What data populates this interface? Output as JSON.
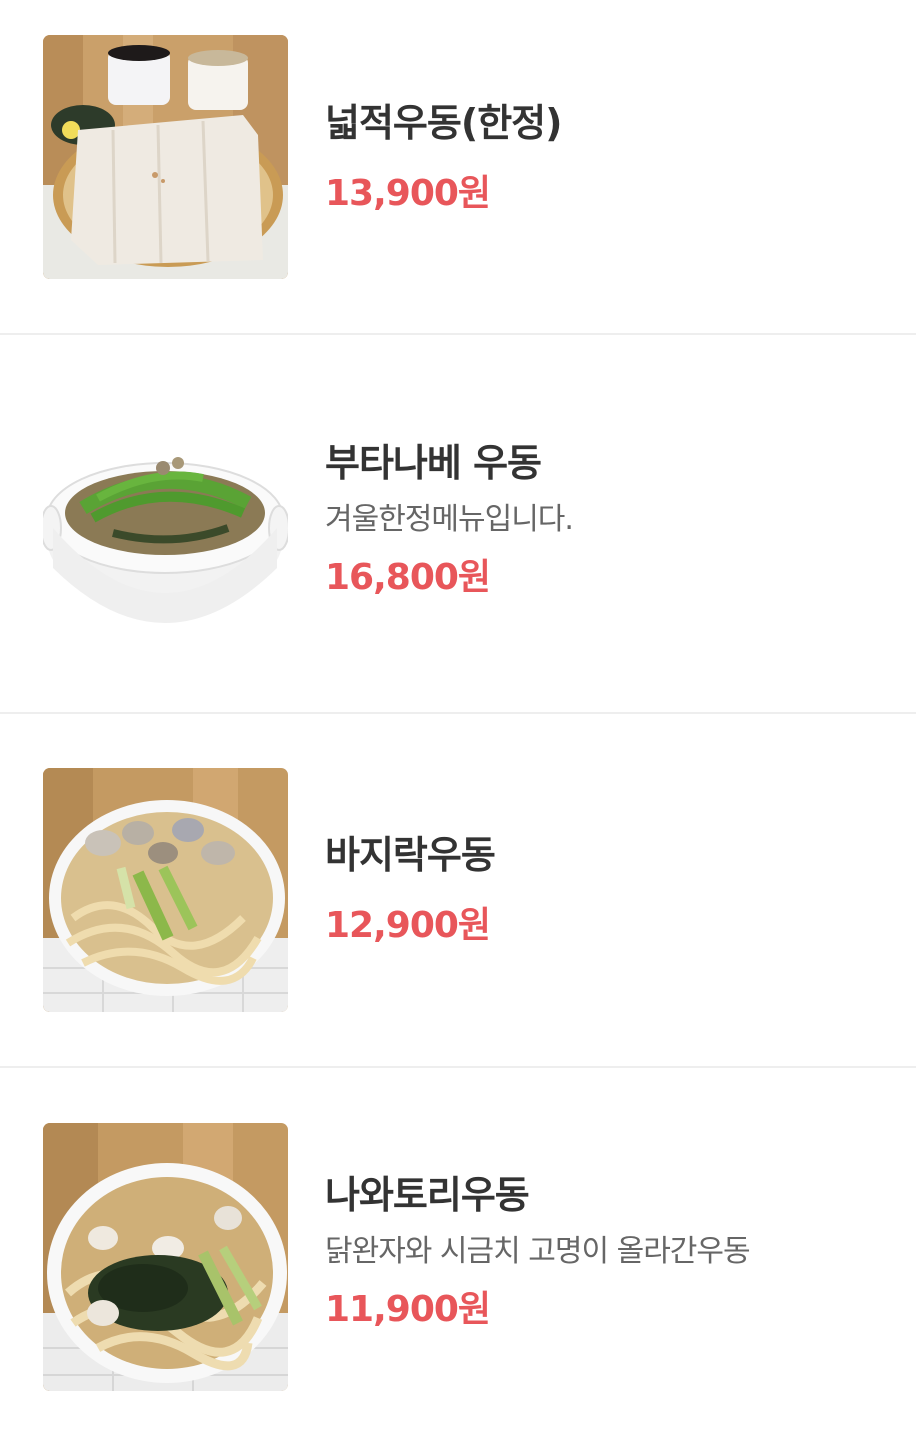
{
  "menu": {
    "items": [
      {
        "name": "넓적우동(한정)",
        "description": "",
        "price": "13,900원",
        "image": "wide-udon-photo"
      },
      {
        "name": "부타나베 우동",
        "description": "겨울한정메뉴입니다.",
        "price": "16,800원",
        "image": "butanabe-udon-photo"
      },
      {
        "name": "바지락우동",
        "description": "",
        "price": "12,900원",
        "image": "clam-udon-photo"
      },
      {
        "name": "나와토리우동",
        "description": "닭완자와 시금치 고명이 올라간우동",
        "price": "11,900원",
        "image": "nawatori-udon-photo"
      }
    ]
  },
  "colors": {
    "price": "#e8565a",
    "name": "#333333",
    "description": "#666666",
    "divider": "#eeeeee"
  }
}
